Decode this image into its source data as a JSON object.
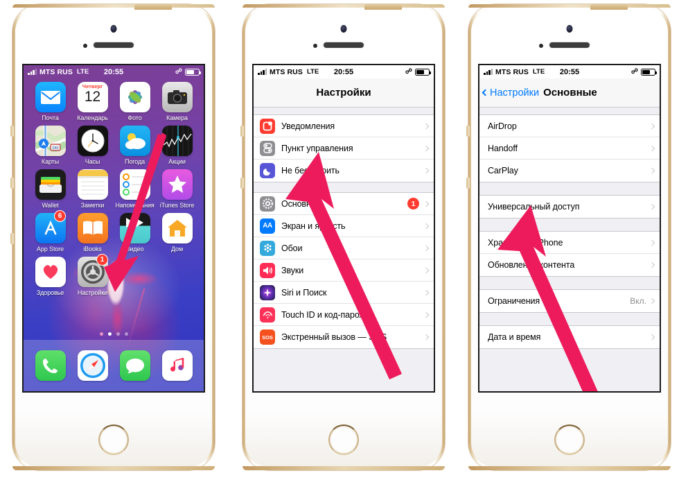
{
  "statusbar": {
    "carrier": "MTS RUS",
    "network": "LTE",
    "time": "20:55",
    "bluetooth": "bluetooth-icon"
  },
  "accent": {
    "arrow": "#ED1B5C",
    "badge": "#ff3b30",
    "link": "#007aff"
  },
  "phone1": {
    "name": "home-screen",
    "wallpaper": "purple-blue-flower",
    "apps": [
      {
        "label": "Почта",
        "icon": "mail-icon"
      },
      {
        "label": "Календарь",
        "icon": "calendar-icon",
        "weekday": "Четверг",
        "day": "12"
      },
      {
        "label": "Фото",
        "icon": "photos-icon"
      },
      {
        "label": "Камера",
        "icon": "camera-icon"
      },
      {
        "label": "Карты",
        "icon": "maps-icon",
        "route": "280"
      },
      {
        "label": "Часы",
        "icon": "clock-icon"
      },
      {
        "label": "Погода",
        "icon": "weather-icon"
      },
      {
        "label": "Акции",
        "icon": "stocks-icon"
      },
      {
        "label": "Wallet",
        "icon": "wallet-icon"
      },
      {
        "label": "Заметки",
        "icon": "notes-icon"
      },
      {
        "label": "Напоминания",
        "icon": "reminders-icon"
      },
      {
        "label": "iTunes Store",
        "icon": "itunes-store-icon"
      },
      {
        "label": "App Store",
        "icon": "app-store-icon",
        "badge": "6"
      },
      {
        "label": "iBooks",
        "icon": "ibooks-icon"
      },
      {
        "label": "Видео",
        "icon": "video-icon"
      },
      {
        "label": "Дом",
        "icon": "home-app-icon"
      },
      {
        "label": "Здоровье",
        "icon": "health-icon"
      },
      {
        "label": "Настройки",
        "icon": "settings-gear-icon",
        "badge": "1"
      }
    ],
    "dock": [
      {
        "label": "Телефон",
        "icon": "phone-icon"
      },
      {
        "label": "Safari",
        "icon": "safari-icon"
      },
      {
        "label": "Сообщения",
        "icon": "messages-icon"
      },
      {
        "label": "Музыка",
        "icon": "music-icon"
      }
    ],
    "page_dots": 4,
    "active_dot": 1
  },
  "phone2": {
    "name": "settings-screen",
    "title": "Настройки",
    "groups": [
      {
        "rows": [
          {
            "label": "Уведомления",
            "icon": "notifications-icon",
            "color": "#ff3b30"
          },
          {
            "label": "Пункт управления",
            "icon": "control-center-icon",
            "color": "#8e8e93"
          },
          {
            "label": "Не беспокоить",
            "icon": "do-not-disturb-icon",
            "color": "#5856d6"
          }
        ]
      },
      {
        "rows": [
          {
            "label": "Основные",
            "icon": "general-gear-icon",
            "color": "#8e8e93",
            "badge": "1"
          },
          {
            "label": "Экран и яркость",
            "icon": "display-brightness-icon",
            "color": "#007aff"
          },
          {
            "label": "Обои",
            "icon": "wallpaper-icon",
            "color": "#34aadc"
          },
          {
            "label": "Звуки",
            "icon": "sounds-icon",
            "color": "#ff2d55"
          },
          {
            "label": "Siri и Поиск",
            "icon": "siri-icon",
            "color": "#1c1c2e"
          },
          {
            "label": "Touch ID и код-пароль",
            "icon": "touch-id-icon",
            "color": "#fc3158"
          },
          {
            "label": "Экстренный вызов — SOS",
            "icon": "sos-icon",
            "color": "#f4511e"
          }
        ]
      }
    ]
  },
  "phone3": {
    "name": "general-settings-screen",
    "back_label": "Настройки",
    "title": "Основные",
    "groups": [
      {
        "rows": [
          {
            "label": "AirDrop"
          },
          {
            "label": "Handoff"
          },
          {
            "label": "CarPlay"
          }
        ]
      },
      {
        "rows": [
          {
            "label": "Универсальный доступ"
          }
        ]
      },
      {
        "rows": [
          {
            "label": "Хранилище iPhone"
          },
          {
            "label": "Обновление контента"
          }
        ]
      },
      {
        "rows": [
          {
            "label": "Ограничения",
            "value": "Вкл."
          }
        ]
      },
      {
        "rows": [
          {
            "label": "Дата и время"
          }
        ]
      }
    ]
  }
}
